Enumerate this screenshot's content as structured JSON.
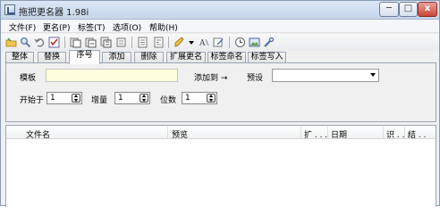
{
  "window": {
    "title": "拖把更名器 1.98i",
    "min_label": "─",
    "max_label": "□",
    "close_label": "x"
  },
  "menu": [
    "文件(F)",
    "更名(P)",
    "标签(T)",
    "选项(O)",
    "帮助(H)"
  ],
  "toolbar": {
    "icons": [
      "open-folder-icon",
      "search-icon",
      "undo-icon",
      "check-icon",
      "rename-icon",
      "rename-alt-icon",
      "rename-all-icon",
      "copy-icon",
      "list-icon",
      "list-alt-icon",
      "brush-icon",
      "dropdown-arrow-icon",
      "text-format-icon",
      "edit-icon",
      "clock-icon",
      "image-icon",
      "tools-icon"
    ]
  },
  "tabs": [
    "整体",
    "替换",
    "序号",
    "添加",
    "删除",
    "扩展更名",
    "标签命名",
    "标签写入"
  ],
  "active_tab": 2,
  "panel": {
    "template_label": "模板",
    "template_value": "",
    "add_to_label": "添加到 →",
    "preset_label": "预设",
    "preset_value": "",
    "start_label": "开始于",
    "start_value": "1",
    "step_label": "增量",
    "step_value": "1",
    "digits_label": "位数",
    "digits_value": "1"
  },
  "list": {
    "columns": [
      "文件名",
      "预览",
      "扩 . . .",
      "日期",
      "识 . . .",
      "结 . ."
    ]
  },
  "colors": {
    "template_bg": "#ffffe0",
    "titlebar": "#c5d6ec",
    "close_button": "#c8473a"
  }
}
